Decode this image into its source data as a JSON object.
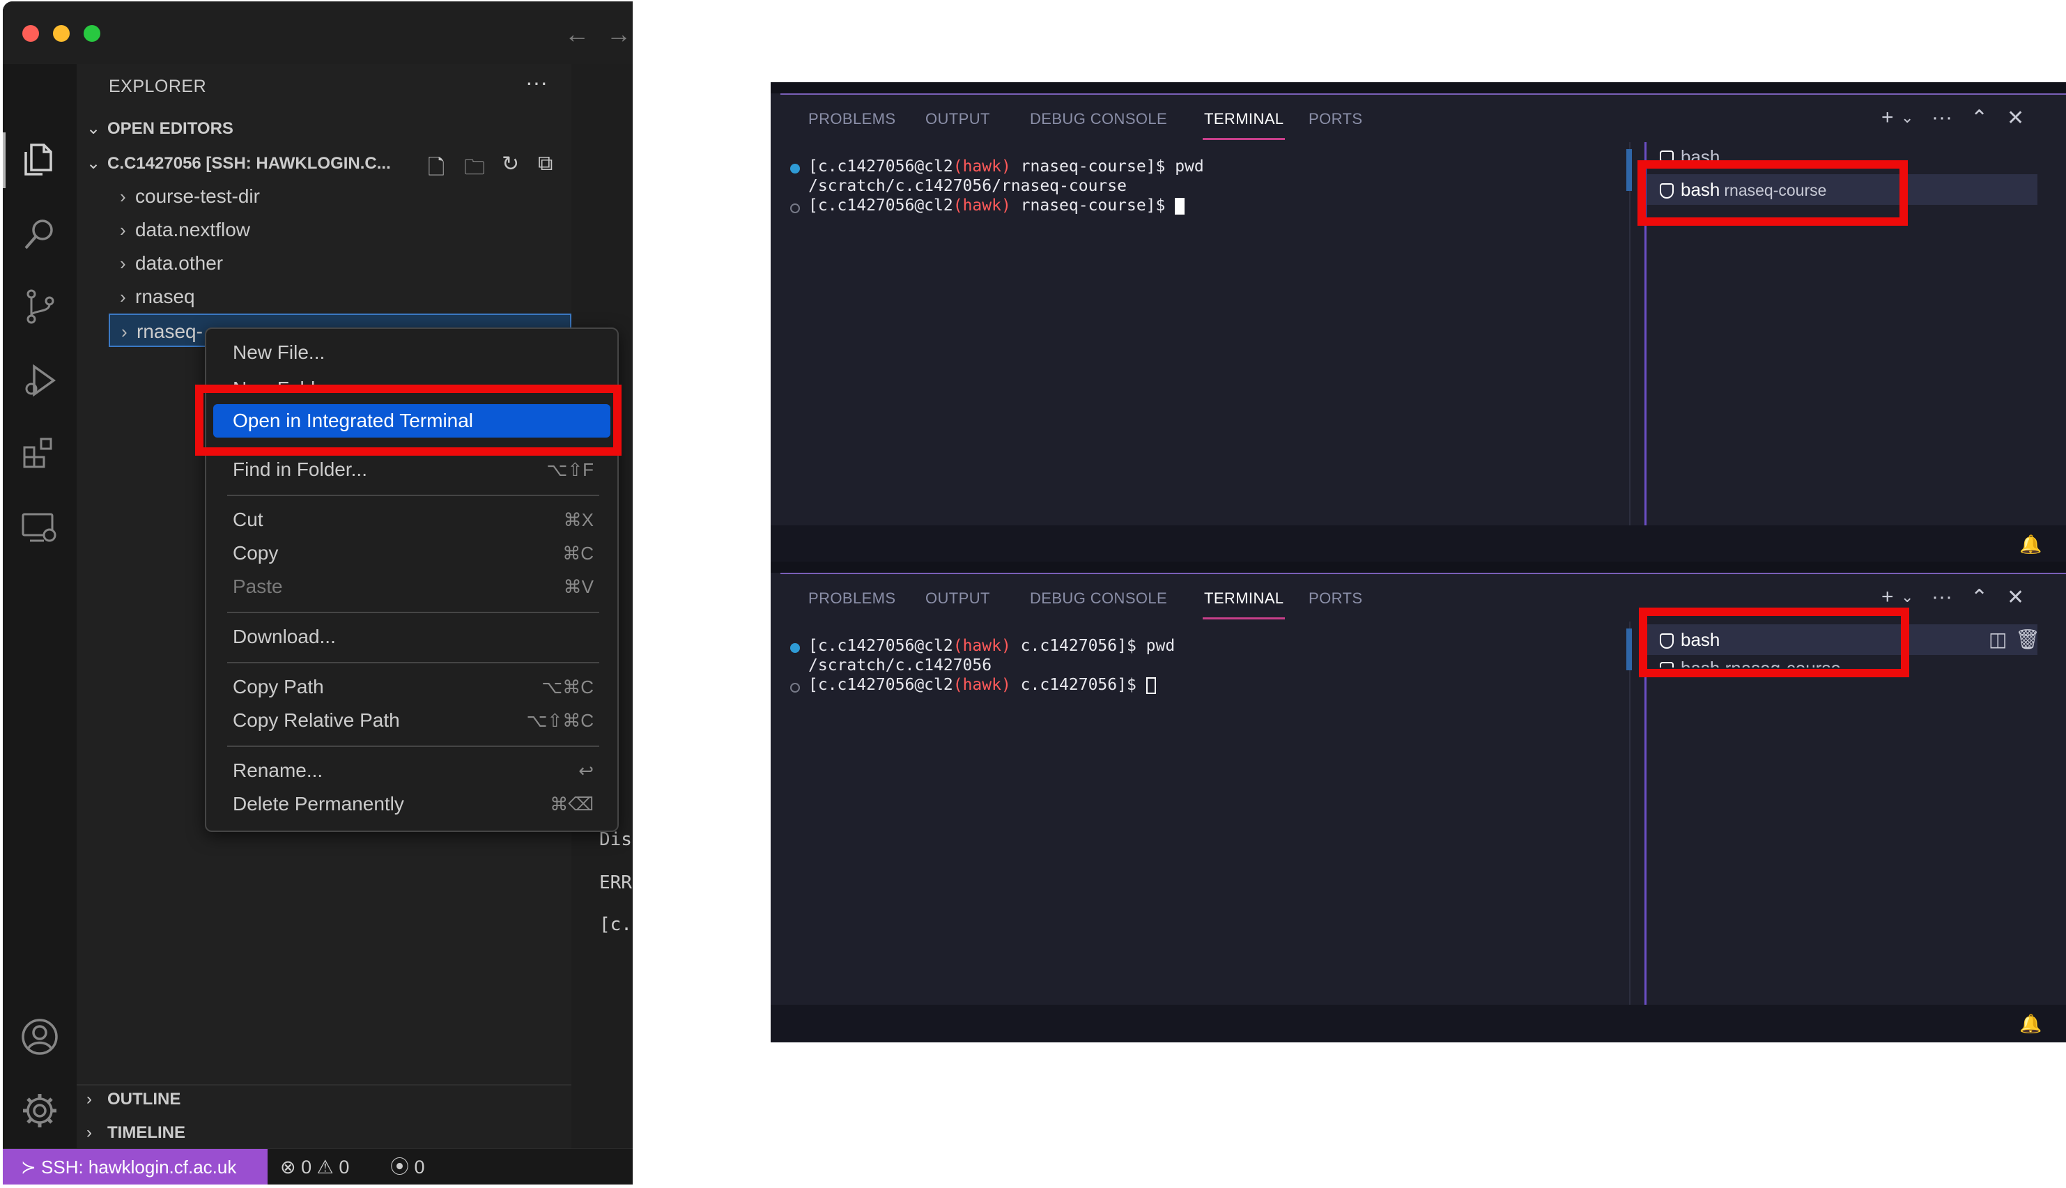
{
  "window": {
    "nav_back": "←",
    "nav_forward": "→"
  },
  "activity_bar": {
    "icons": [
      "files-icon",
      "search-icon",
      "source-control-icon",
      "run-debug-icon",
      "extensions-icon",
      "remote-explorer-icon",
      "account-icon",
      "settings-gear-icon"
    ]
  },
  "explorer": {
    "title": "EXPLORER",
    "more": "···",
    "open_editors": "OPEN EDITORS",
    "folder": "C.C1427056 [SSH: HAWKLOGIN.C...",
    "items": [
      {
        "label": "course-test-dir"
      },
      {
        "label": "data.nextflow"
      },
      {
        "label": "data.other"
      },
      {
        "label": "rnaseq"
      },
      {
        "label": "rnaseq-"
      }
    ],
    "outline": "OUTLINE",
    "timeline": "TIMELINE"
  },
  "editor_peek": {
    "lines": [
      "Dis",
      "ERR",
      "[c."
    ]
  },
  "context_menu": {
    "new_file": "New File...",
    "new_folder": "New Folder...",
    "open_terminal": "Open in Integrated Terminal",
    "find_in_folder": "Find in Folder...",
    "find_in_folder_sc": "⌥⇧F",
    "cut": "Cut",
    "cut_sc": "⌘X",
    "copy": "Copy",
    "copy_sc": "⌘C",
    "paste": "Paste",
    "paste_sc": "⌘V",
    "download": "Download...",
    "copy_path": "Copy Path",
    "copy_path_sc": "⌥⌘C",
    "copy_relative_path": "Copy Relative Path",
    "copy_relative_path_sc": "⌥⇧⌘C",
    "rename": "Rename...",
    "rename_sc": "↩",
    "delete": "Delete Permanently",
    "delete_sc": "⌘⌫"
  },
  "statusbar": {
    "ssh": "SSH: hawklogin.cf.ac.uk",
    "errors": "0",
    "warnings": "0",
    "ports": "0"
  },
  "terminal_panels": [
    {
      "tabs": [
        "PROBLEMS",
        "OUTPUT",
        "DEBUG CONSOLE",
        "TERMINAL",
        "PORTS"
      ],
      "active_tab": "TERMINAL",
      "lines": [
        {
          "prefix": "[c.c1427056@cl2",
          "host": "(hawk)",
          "suffix": " rnaseq-course]$ pwd"
        },
        {
          "text": "/scratch/c.c1427056/rnaseq-course"
        },
        {
          "prefix": "[c.c1427056@cl2",
          "host": "(hawk)",
          "suffix": " rnaseq-course]$ "
        }
      ],
      "list": {
        "ghost": "bash",
        "selected_name": "bash",
        "selected_sub": "rnaseq-course"
      }
    },
    {
      "tabs": [
        "PROBLEMS",
        "OUTPUT",
        "DEBUG CONSOLE",
        "TERMINAL",
        "PORTS"
      ],
      "active_tab": "TERMINAL",
      "lines": [
        {
          "prefix": "[c.c1427056@cl2",
          "host": "(hawk)",
          "suffix": " c.c1427056]$ pwd"
        },
        {
          "text": "/scratch/c.c1427056"
        },
        {
          "prefix": "[c.c1427056@cl2",
          "host": "(hawk)",
          "suffix": " c.c1427056]$ "
        }
      ],
      "list": {
        "selected_name": "bash",
        "ghost": "bash  rnaseq-course"
      }
    }
  ],
  "colors": {
    "highlight_red": "#ee0a0a",
    "menu_selection": "#0a59d6",
    "ssh_badge": "#9a4fd0",
    "terminal_host": "#ff5a5a"
  }
}
